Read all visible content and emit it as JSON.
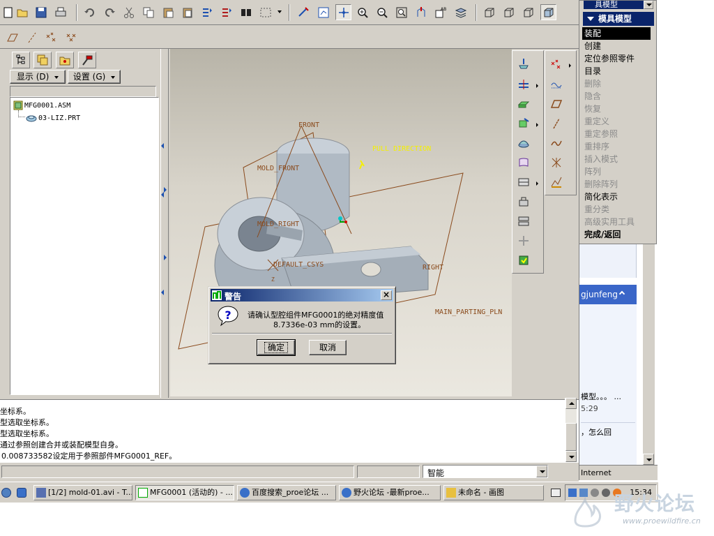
{
  "app": {
    "title": "MFG0001 (活动的)"
  },
  "menu_manager": {
    "header_partial": "具模型",
    "title": "模具模型",
    "items": [
      {
        "label": "装配",
        "state": "selected"
      },
      {
        "label": "创建",
        "state": "enabled"
      },
      {
        "label": "定位参照零件",
        "state": "enabled"
      },
      {
        "label": "目录",
        "state": "enabled"
      },
      {
        "label": "删除",
        "state": "disabled"
      },
      {
        "label": "隐含",
        "state": "disabled"
      },
      {
        "label": "恢复",
        "state": "disabled"
      },
      {
        "label": "重定义",
        "state": "disabled"
      },
      {
        "label": "重定参照",
        "state": "disabled"
      },
      {
        "label": "重排序",
        "state": "disabled"
      },
      {
        "label": "插入模式",
        "state": "disabled"
      },
      {
        "label": "阵列",
        "state": "disabled"
      },
      {
        "label": "删除阵列",
        "state": "disabled"
      },
      {
        "label": "简化表示",
        "state": "enabled"
      },
      {
        "label": "重分类",
        "state": "disabled"
      },
      {
        "label": "高级实用工具",
        "state": "disabled"
      },
      {
        "label": "完成/返回",
        "state": "bold"
      }
    ]
  },
  "model_tree": {
    "show_label": "显示 (D)",
    "settings_label": "设置 (G)",
    "items": [
      {
        "label": "MFG0001.ASM",
        "icon": "assembly-icon"
      },
      {
        "label": "03-LIZ.PRT",
        "icon": "part-icon"
      }
    ]
  },
  "viewport": {
    "datum_labels": {
      "front": "FRONT",
      "pull_direction": "PULL DIRECTION",
      "mold_front": "MOLD_FRONT",
      "mold_right": "MOLD_RIGHT",
      "default_csys": "DEFAULT_CSYS",
      "right": "RIGHT",
      "main_parting_pln": "MAIN_PARTING_PLN",
      "z_axis": "Z"
    }
  },
  "dialog": {
    "title": "警告",
    "message_line1": "请确认型腔组件MFG0001的绝对精度值",
    "message_line2": "8.7336e-03 mm的设置。",
    "ok_label": "确定",
    "cancel_label": "取消",
    "icon": "question-icon"
  },
  "message_area": {
    "lines": [
      "坐标系。",
      "型选取坐标系。",
      "型选取坐标系。",
      "通过参照创建合并或装配模型自身。",
      "0.008733582设定用于参照部件MFG0001_REF。"
    ]
  },
  "status": {
    "filter_value": "智能"
  },
  "browser_bg": {
    "user": "gjunfeng",
    "snippet1": "模型。。。 ...",
    "snippet1_time": "5:29",
    "snippet2": "，怎么回",
    "zone": "Internet"
  },
  "taskbar": {
    "tasks": [
      {
        "label": "[1/2] mold-01.avi - T...",
        "active": false
      },
      {
        "label": "MFG0001 (活动的) - ...",
        "active": true
      },
      {
        "label": "百度搜索_proe论坛 ...",
        "active": false
      },
      {
        "label": "野火论坛 -最新proe...",
        "active": false
      },
      {
        "label": "未命名 - 画图",
        "active": false
      }
    ],
    "clock": "15:34"
  },
  "watermark": {
    "name": "野火论坛",
    "url": "www.proewildfire.cn"
  },
  "colors": {
    "window_face": "#d4d0c8",
    "menu_header": "#0a246a",
    "datum_orange": "#8a4a1c",
    "datum_yellow": "#f5f000",
    "model_gray": "#b8c2cc",
    "viewport_top": "#b8b4a8",
    "viewport_bottom": "#ebe8e0"
  }
}
